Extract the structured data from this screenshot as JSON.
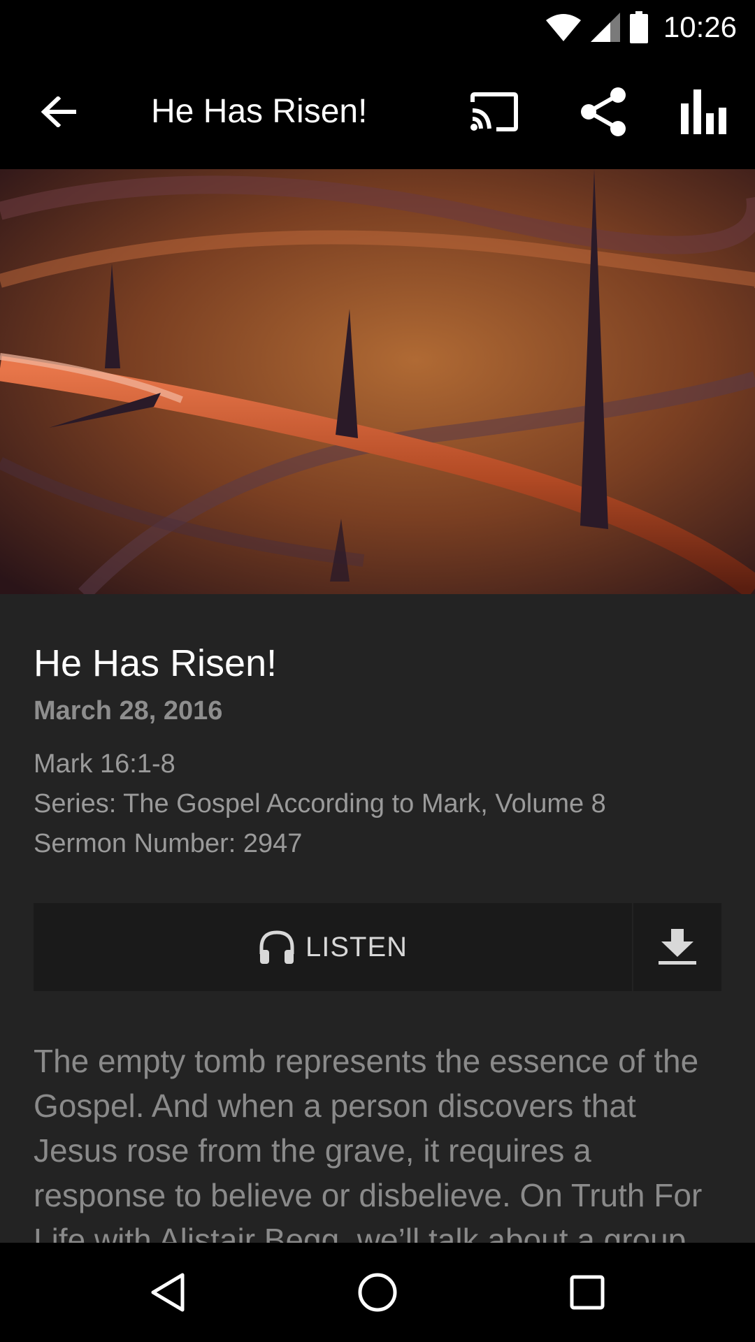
{
  "status_bar": {
    "time": "10:26",
    "icons": [
      "wifi-icon",
      "cell-signal-icon",
      "battery-icon"
    ]
  },
  "toolbar": {
    "title": "He Has Risen!",
    "icons": [
      "back-arrow-icon",
      "cast-icon",
      "share-icon",
      "bar-chart-icon"
    ]
  },
  "hero_image": {
    "description_icon": "thorn-branch-image"
  },
  "sermon": {
    "title": "He Has Risen!",
    "date": "March 28, 2016",
    "scripture": "Mark 16:1-8",
    "series": "Series: The Gospel According to Mark, Volume 8",
    "number": "Sermon Number: 2947"
  },
  "actions": {
    "listen_label": "LISTEN",
    "listen_icon": "headphones-icon",
    "download_icon": "download-icon"
  },
  "description": "The empty tomb represents the essence of the Gospel. And when a person discovers that Jesus rose from the grave, it requires a response to believe or disbelieve. On Truth For Life with Alistair Begg, we’ll talk about a group",
  "nav_bar": {
    "icons": [
      "back-triangle-icon",
      "home-circle-icon",
      "recents-square-icon"
    ]
  },
  "colors": {
    "background": "#232323",
    "bars": "#000000",
    "button": "#1a1a1a",
    "muted_text": "#8a8a8a"
  }
}
